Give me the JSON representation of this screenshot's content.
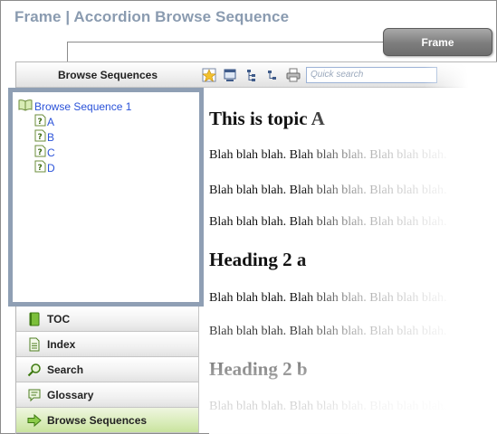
{
  "doc_title": "Frame | Accordion Browse Sequence",
  "callout_label": "Frame",
  "toolbar": {
    "title": "Browse Sequences",
    "search_placeholder": "Quick search",
    "icons": [
      "highlight-icon",
      "print-topic-icon",
      "expand-all-icon",
      "collapse-all-icon",
      "print-icon"
    ]
  },
  "tree": {
    "root": "Browse Sequence 1",
    "children": [
      "A",
      "B",
      "C",
      "D"
    ]
  },
  "accordion": [
    {
      "label": "TOC",
      "icon": "book-icon"
    },
    {
      "label": "Index",
      "icon": "index-icon"
    },
    {
      "label": "Search",
      "icon": "magnifier-icon"
    },
    {
      "label": "Glossary",
      "icon": "glossary-icon"
    },
    {
      "label": "Browse Sequences",
      "icon": "arrow-right-icon",
      "active": true
    }
  ],
  "content": {
    "heading1": "This is topic A",
    "para1": "Blah blah blah. Blah blah blah. Blah blah blah.",
    "para2": "Blah blah blah. Blah blah blah. Blah blah blah.",
    "para3": "Blah blah blah. Blah blah blah. Blah blah blah.",
    "heading2a": "Heading 2 a",
    "para4": "Blah blah blah. Blah blah blah. Blah blah blah.",
    "para5": "Blah blah blah. Blah blah blah. Blah blah blah.",
    "heading2b": "Heading 2 b",
    "para6": "Blah blah blah. Blah blah blah. Blah blah blah."
  },
  "colors": {
    "title": "#8a9bb0",
    "panel_border": "#8f9fb4",
    "link": "#2a52d9",
    "active_tab": "#c9e39e"
  }
}
